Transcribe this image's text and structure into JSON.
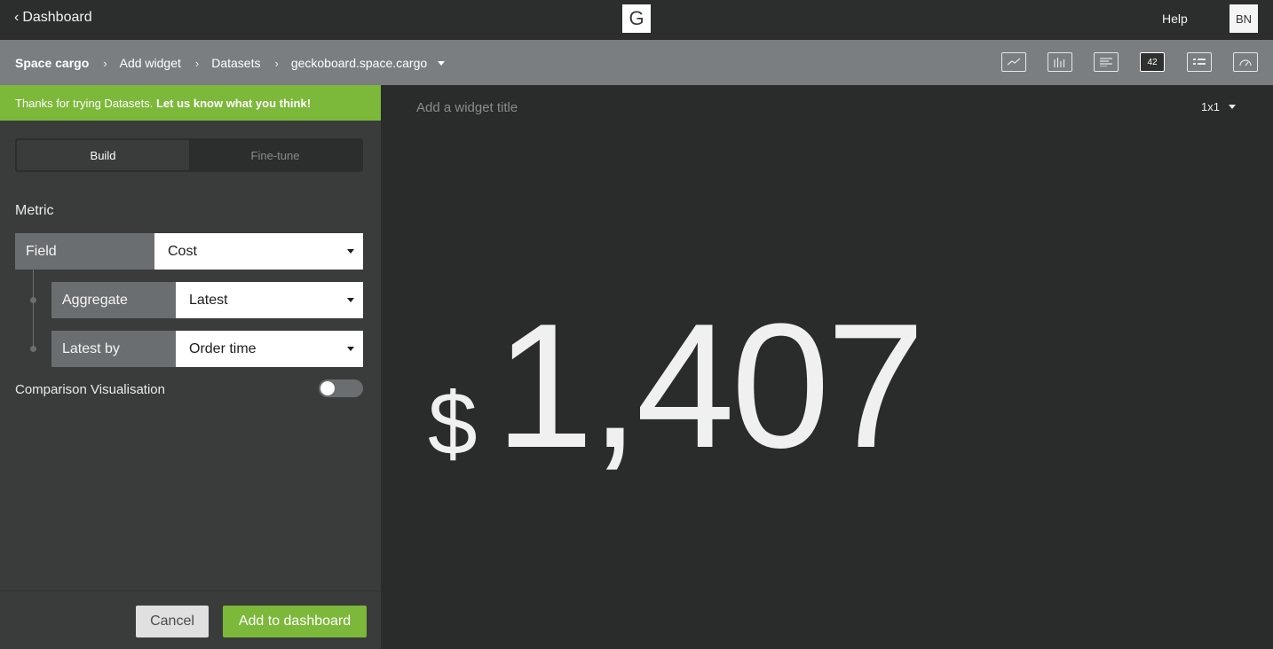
{
  "topbar": {
    "back_label": "Dashboard",
    "logo_letter": "G",
    "help_label": "Help",
    "avatar_initials": "BN"
  },
  "breadcrumb": {
    "items": [
      "Space cargo",
      "Add widget",
      "Datasets",
      "geckoboard.space.cargo"
    ]
  },
  "viz_types": [
    {
      "name": "line-chart",
      "label": ""
    },
    {
      "name": "column-chart",
      "label": ""
    },
    {
      "name": "leaderboard",
      "label": ""
    },
    {
      "name": "number",
      "label": "42"
    },
    {
      "name": "list",
      "label": ""
    },
    {
      "name": "gauge",
      "label": ""
    }
  ],
  "banner": {
    "text": "Thanks for trying Datasets.",
    "link": "Let us know what you think!"
  },
  "tabs": {
    "build": "Build",
    "finetune": "Fine-tune",
    "active": "build"
  },
  "metric": {
    "heading": "Metric",
    "field": {
      "label": "Field",
      "value": "Cost"
    },
    "aggregate": {
      "label": "Aggregate",
      "value": "Latest"
    },
    "latest_by": {
      "label": "Latest by",
      "value": "Order time"
    }
  },
  "comparison": {
    "label": "Comparison Visualisation",
    "enabled": false
  },
  "footer": {
    "cancel_label": "Cancel",
    "add_label": "Add to dashboard"
  },
  "preview": {
    "title_placeholder": "Add a widget title",
    "size": "1x1",
    "currency": "$",
    "value": "1,407"
  },
  "colors": {
    "accent_green": "#7cb83a",
    "topbar": "#2c2d2d",
    "crumbbar": "#7a7e80",
    "panel": "#3a3b3b",
    "preview_bg": "#2a2b2b"
  }
}
